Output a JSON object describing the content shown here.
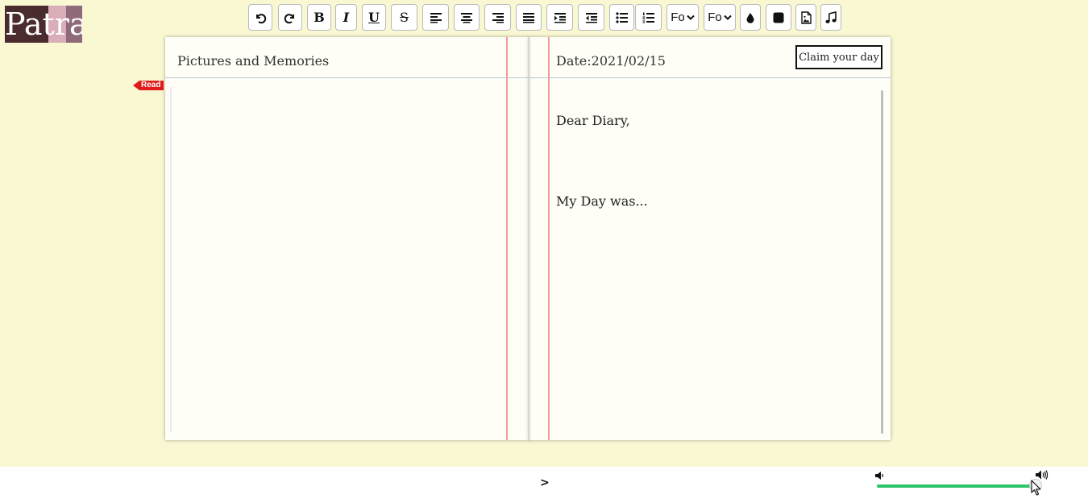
{
  "app": {
    "logo_text": "Patra",
    "logo_colors": [
      "#4a2c2e",
      "#d9aeb8",
      "#8f6a7b"
    ]
  },
  "toolbar": {
    "undo_icon": "undo-icon",
    "redo_icon": "redo-icon",
    "bold_label": "B",
    "italic_label": "I",
    "underline_label": "U",
    "strike_label": "S",
    "align_left_icon": "align-left-icon",
    "align_center_icon": "align-center-icon",
    "align_right_icon": "align-right-icon",
    "justify_icon": "justify-icon",
    "indent_icon": "indent-icon",
    "outdent_icon": "outdent-icon",
    "bullet_list_icon": "bullet-list-icon",
    "numbered_list_icon": "numbered-list-icon",
    "font_family_value": "Fo",
    "font_size_value": "Fo",
    "text_color_icon": "droplet-icon",
    "highlight_icon": "square-icon",
    "image_icon": "image-icon",
    "music_icon": "music-icon"
  },
  "diary": {
    "left_page_title": "Pictures and Memories",
    "date_label": "Date:2021/02/15",
    "claim_button": "Claim your day",
    "body_line_1": "Dear Diary,",
    "body_line_2": "My Day was..."
  },
  "read_tag": {
    "label": "Read",
    "color": "#e01b1b"
  },
  "footer": {
    "next_label": ">",
    "volume_level": 0.98,
    "volume_color": "#2ec46a"
  }
}
